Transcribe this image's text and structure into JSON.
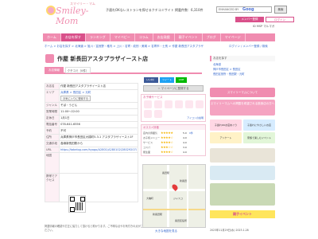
{
  "header": {
    "logo_small": "スマイリー・マム",
    "logo_main": "Smiley-Mom",
    "tagline": "子連れOKなレストランを探せるクチコミサイト 掲載件数：6,310件",
    "search_placeholder": "ENHANCED BY",
    "search_brand": "Goog",
    "search_button": "検索",
    "register": "メンバー登録",
    "login": "ログイン",
    "subscribe": "ID MSP マルマガ"
  },
  "nav": [
    "ホーム",
    "お店を探す",
    "ランキング",
    "マイベビー",
    "コラム",
    "お店発掘",
    "親子イベント",
    "ブログ",
    "マイページ"
  ],
  "breadcrumb": "ホーム > お店を探す > 北海道 > 旭川・富良野・稚内 > 上川・名寄・紋別・美瑛 > 名寄市・士別 > 作屋 新長田アスタプラザイースト店",
  "breadcrumb_right": "ログイン / メンバー登録 / 検索",
  "title": "作屋 新長田アスタプラザイースト店",
  "tabs": [
    "お店情報",
    "クチコミ（0件）"
  ],
  "info": {
    "rows": [
      {
        "k": "お店名",
        "v": "作屋 新長田アスタプラザイースト店"
      },
      {
        "k": "エリア",
        "v": "兵庫県 > 長田区 > 元町"
      },
      {
        "k": "",
        "v": "お気に入りに登録する"
      },
      {
        "k": "ジャンル",
        "v": "そば・うどん"
      },
      {
        "k": "営業時間",
        "v": "11:00～22:00"
      },
      {
        "k": "定休日",
        "v": "1月1日"
      },
      {
        "k": "電話番号",
        "v": "078-641-6556"
      },
      {
        "k": "予約",
        "v": "不可"
      },
      {
        "k": "住所",
        "v": "兵庫県神戸市長田区大橋町5-3-1 アスタプラザイースト1F"
      },
      {
        "k": "交通手段",
        "v": "各線新長田駅から"
      },
      {
        "k": "URL",
        "v": "https://tabelog.com/hyogo/A2801/A280102/28029207/"
      },
      {
        "k": "地図",
        "v": ""
      },
      {
        "k": "携帯でアクセス",
        "v": ""
      }
    ]
  },
  "footnote": "掲載情報の確認や訂正に協力して頂けると助かります。ご不明な点やお気付きの点がございましたら、お問い合わせフォームよりご連絡ください。",
  "social": [
    "いいね！",
    "ツイート",
    "LINE"
  ],
  "mypage_button": "☆ マイページに登録する",
  "services": {
    "title": "お子様サービス",
    "more": "アイコンの説明"
  },
  "rating": {
    "title": "オススメ評価",
    "rows": [
      {
        "label": "店内の雰囲気",
        "stars": "★★★★★",
        "value": "5.0"
      },
      {
        "label": "お子様メニュー",
        "stars": "★★★★☆",
        "value": "4.0"
      },
      {
        "label": "サービス",
        "stars": "★★★★☆",
        "value": "4.0"
      },
      {
        "label": "コスパ",
        "stars": "★★★☆☆",
        "value": "3.0"
      },
      {
        "label": "衛生面",
        "stars": "★★★★☆",
        "value": "4.0"
      }
    ],
    "count": "0件"
  },
  "map": {
    "labels": [
      "長田駅",
      "新長田",
      "大橋町",
      "ジャスコ",
      "新長田駅",
      "長田区役所"
    ],
    "link": "大きな地図を見る"
  },
  "side": {
    "heading": "お店を探す",
    "links": [
      "北海道",
      "神戸市長田区 > 長田区",
      "長田区役所・長田駅・元町"
    ]
  },
  "banners": [
    "スマイリーマムについて",
    "スマイリーマムへの掲載を希望される飲食店の方へ"
  ],
  "tiles": [
    "子連れOKお店めぐり",
    "子連れにやさしいお店",
    "アンケート",
    "家族で楽しむイベント"
  ],
  "event": "親子イベント",
  "cal": "2023年11月29日(水)   2023.1.28"
}
